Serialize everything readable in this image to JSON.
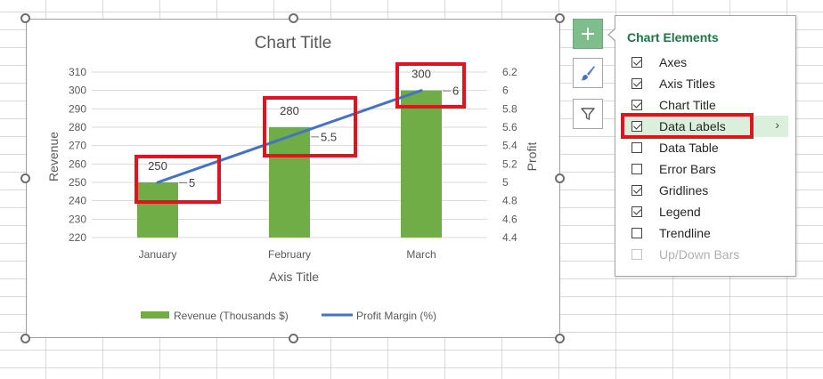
{
  "chart_data": {
    "type": "bar",
    "title": "Chart Title",
    "xlabel": "Axis Title",
    "ylabel": "Revenue",
    "y2label": "Profit",
    "categories": [
      "January",
      "February",
      "March"
    ],
    "series": [
      {
        "name": "Revenue (Thousands $)",
        "type": "bar",
        "axis": "left",
        "values": [
          250,
          280,
          300
        ],
        "color": "#70ad47"
      },
      {
        "name": "Profit Margin (%)",
        "type": "line",
        "axis": "right",
        "values": [
          5,
          5.5,
          6
        ],
        "color": "#4472c4"
      }
    ],
    "ylim": [
      220,
      310
    ],
    "yticks": [
      "220",
      "230",
      "240",
      "250",
      "260",
      "270",
      "280",
      "290",
      "300",
      "310"
    ],
    "y2lim": [
      4.4,
      6.2
    ],
    "y2ticks": [
      "4.4",
      "4.6",
      "4.8",
      "5",
      "5.2",
      "5.4",
      "5.6",
      "5.8",
      "6",
      "6.2"
    ],
    "bar_labels": [
      "250",
      "280",
      "300"
    ],
    "line_labels": [
      "5",
      "5.5",
      "6"
    ],
    "grid": true,
    "legend": "bottom"
  },
  "side_buttons": {
    "add": "plus-icon",
    "styles": "paintbrush-icon",
    "filters": "funnel-icon"
  },
  "chart_elements": {
    "title": "Chart Elements",
    "items": [
      {
        "label": "Axes",
        "checked": true
      },
      {
        "label": "Axis Titles",
        "checked": true
      },
      {
        "label": "Chart Title",
        "checked": true
      },
      {
        "label": "Data Labels",
        "checked": true,
        "selected": true,
        "submenu": "›"
      },
      {
        "label": "Data Table",
        "checked": false
      },
      {
        "label": "Error Bars",
        "checked": false
      },
      {
        "label": "Gridlines",
        "checked": true
      },
      {
        "label": "Legend",
        "checked": true
      },
      {
        "label": "Trendline",
        "checked": false
      },
      {
        "label": "Up/Down Bars",
        "checked": false,
        "disabled": true
      }
    ]
  },
  "colors": {
    "accent_green": "#217346",
    "highlight_red": "#e0141e",
    "bar_green": "#70ad47",
    "line_blue": "#4472c4"
  }
}
